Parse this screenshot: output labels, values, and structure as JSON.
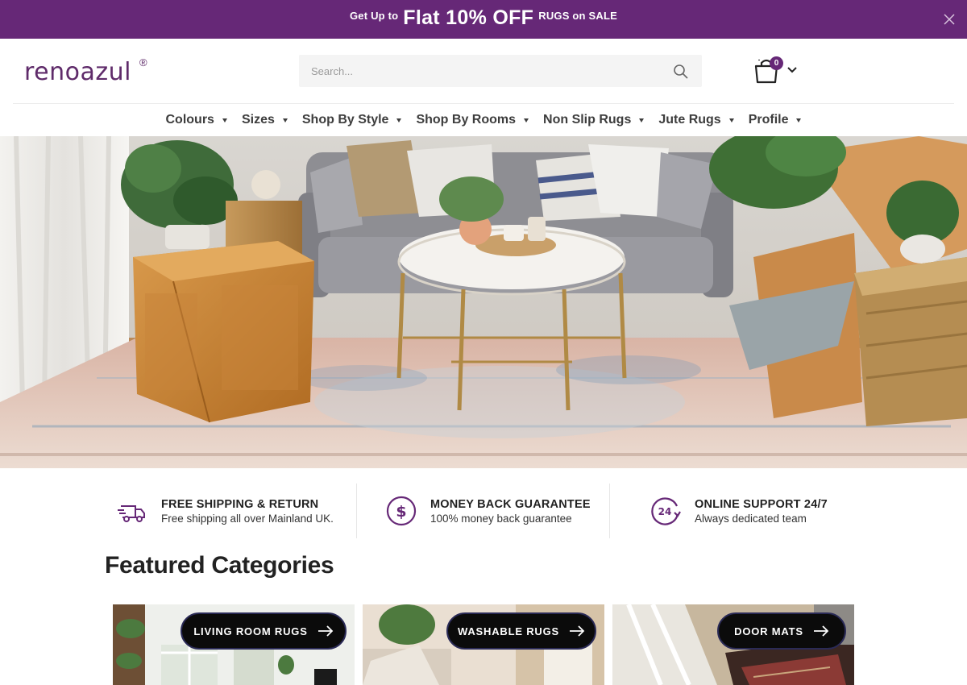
{
  "promo": {
    "prefix": "Get Up to",
    "highlight": "Flat 10% OFF",
    "suffix": "RUGS on SALE",
    "background_color": "#662877",
    "close_icon": "close-icon"
  },
  "header": {
    "logo_text": "renoazul",
    "logo_mark": "®",
    "search_placeholder": "Search...",
    "search_icon": "search-icon",
    "cart_icon": "shopping-bag-icon",
    "cart_count": "0",
    "cart_caret_icon": "chevron-down-icon",
    "brand_color": "#5f2b6a"
  },
  "nav": {
    "items": [
      {
        "label": "Colours"
      },
      {
        "label": "Sizes"
      },
      {
        "label": "Shop By Style"
      },
      {
        "label": "Shop By Rooms"
      },
      {
        "label": "Non Slip Rugs"
      },
      {
        "label": "Jute Rugs"
      },
      {
        "label": "Profile"
      }
    ]
  },
  "hero": {
    "image_subject": "living room with grey sofa, round marble coffee table, wicker ottoman and pastel distressed rug"
  },
  "features": [
    {
      "icon": "delivery-truck-icon",
      "title": "FREE SHIPPING & RETURN",
      "desc": "Free shipping all over Mainland UK."
    },
    {
      "icon": "dollar-circle-icon",
      "title": "MONEY BACK GUARANTEE",
      "desc": "100% money back guarantee"
    },
    {
      "icon": "support-24-icon",
      "title": "ONLINE SUPPORT 24/7",
      "desc": "Always dedicated team"
    }
  ],
  "featured": {
    "title": "Featured Categories",
    "cards": [
      {
        "label": "LIVING ROOM RUGS"
      },
      {
        "label": "WASHABLE RUGS"
      },
      {
        "label": "DOOR MATS"
      }
    ]
  },
  "colors": {
    "accent": "#662877",
    "button_bg": "#0b0b0b"
  }
}
